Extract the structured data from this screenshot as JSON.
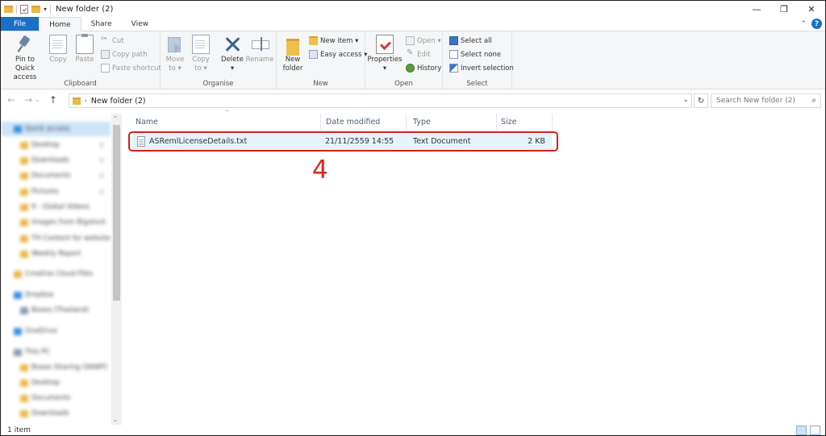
{
  "window": {
    "title": "New folder (2)"
  },
  "ribbon_tabs": [
    "File",
    "Home",
    "Share",
    "View"
  ],
  "ribbon": {
    "clipboard": {
      "label": "Clipboard",
      "pin_line1": "Pin to Quick",
      "pin_line2": "access",
      "copy": "Copy",
      "paste": "Paste",
      "cut": "Cut",
      "copy_path": "Copy path",
      "paste_shortcut": "Paste shortcut"
    },
    "organise": {
      "label": "Organise",
      "move_line1": "Move",
      "move_line2": "to ▾",
      "copy_line1": "Copy",
      "copy_line2": "to ▾",
      "delete": "Delete",
      "delete_dd": "▾",
      "rename": "Rename"
    },
    "new": {
      "label": "New",
      "folder_line1": "New",
      "folder_line2": "folder",
      "new_item": "New item ▾",
      "easy_access": "Easy access ▾"
    },
    "open": {
      "label": "Open",
      "properties": "Properties",
      "properties_dd": "▾",
      "open": "Open ▾",
      "edit": "Edit",
      "history": "History"
    },
    "select": {
      "label": "Select",
      "select_all": "Select all",
      "select_none": "Select none",
      "invert": "Invert selection"
    }
  },
  "address": {
    "crumb": "New folder (2)",
    "search_placeholder": "Search New folder (2)"
  },
  "nav_pane": [
    {
      "label": "Quick access",
      "icon": "blue"
    },
    {
      "label": "Desktop",
      "icon": "yel",
      "pinned": true
    },
    {
      "label": "Downloads",
      "icon": "yel",
      "pinned": true
    },
    {
      "label": "Documents",
      "icon": "yel",
      "pinned": true
    },
    {
      "label": "Pictures",
      "icon": "yel",
      "pinned": true
    },
    {
      "label": "9 - Global Videos",
      "icon": "yel"
    },
    {
      "label": "Images from Bigstock",
      "icon": "yel"
    },
    {
      "label": "TH Content for website",
      "icon": "yel"
    },
    {
      "label": "Weekly Report",
      "icon": "yel"
    },
    {
      "label": "Creative Cloud Files",
      "icon": "yel"
    },
    {
      "label": "Dropbox",
      "icon": "blue"
    },
    {
      "label": "Boxes (Thailand)",
      "icon": "gray"
    },
    {
      "label": "OneDrive",
      "icon": "blue"
    },
    {
      "label": "This PC",
      "icon": "gray"
    },
    {
      "label": "Boxes Sharing (SKWP)",
      "icon": "yel"
    },
    {
      "label": "Desktop",
      "icon": "yel"
    },
    {
      "label": "Documents",
      "icon": "yel"
    },
    {
      "label": "Downloads",
      "icon": "yel"
    }
  ],
  "columns": {
    "name": "Name",
    "date": "Date modified",
    "type": "Type",
    "size": "Size"
  },
  "files": [
    {
      "name": "ASRemlLicenseDetails.txt",
      "date": "21/11/2559 14:55",
      "type": "Text Document",
      "size": "2 KB"
    }
  ],
  "annotation": {
    "step": "4"
  },
  "status": {
    "count": "1 item"
  },
  "colors": {
    "accent": "#1a6fc6",
    "highlight": "#d81e1e"
  }
}
